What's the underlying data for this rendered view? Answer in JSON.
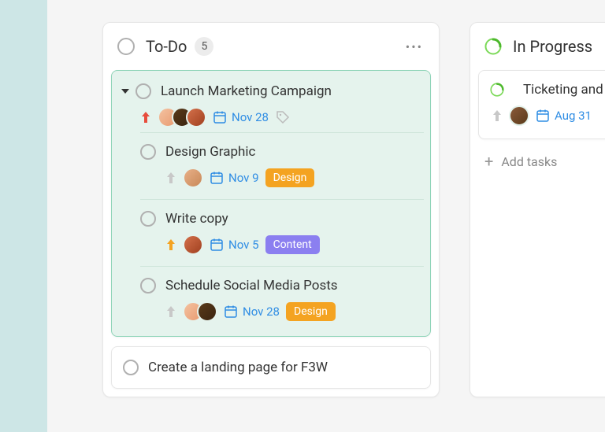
{
  "columns": {
    "todo": {
      "title": "To-Do",
      "count": "5",
      "parent": {
        "title": "Launch Marketing Campaign",
        "date": "Nov 28"
      },
      "subtasks": [
        {
          "title": "Design Graphic",
          "date": "Nov 9",
          "label": "Design"
        },
        {
          "title": "Write copy",
          "date": "Nov 5",
          "label": "Content"
        },
        {
          "title": "Schedule Social Media Posts",
          "date": "Nov 28",
          "label": "Design"
        }
      ],
      "plain": {
        "title": "Create a landing page for F3W"
      }
    },
    "inprogress": {
      "title": "In Progress",
      "card": {
        "title": "Ticketing and r",
        "date": "Aug 31"
      },
      "add_label": "Add tasks"
    }
  }
}
